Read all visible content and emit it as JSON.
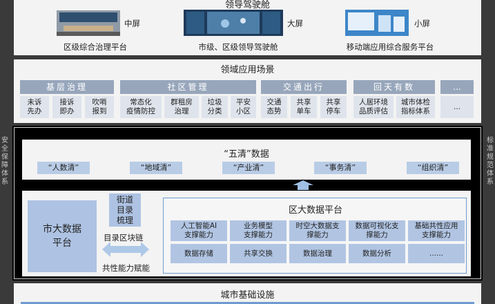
{
  "side_left": "安全保障体系",
  "side_right": "标准规范体系",
  "cockpit": {
    "title": "领导驾驶舱",
    "screens": [
      {
        "size": "中屏",
        "caption": "区级综合治理平台"
      },
      {
        "size": "大屏",
        "caption": "市级、区级领导驾驶舱"
      },
      {
        "size": "小屏",
        "caption": "移动端应用综合服务平台"
      }
    ]
  },
  "scenes": {
    "title": "领域应用场景",
    "groups": [
      {
        "header": "基层治理",
        "items": [
          "未诉\n先办",
          "接诉\n即办",
          "吹哨\n报到"
        ]
      },
      {
        "header": "社区管理",
        "items": [
          "常态化\n疫情防控",
          "群租房\n治理",
          "垃圾\n分类",
          "平安\n小区"
        ]
      },
      {
        "header": "交通出行",
        "items": [
          "交通\n态势",
          "共享\n单车",
          "共享\n停车"
        ]
      },
      {
        "header": "回天有数",
        "items": [
          "人居环境\n品质评估",
          "城市体检\n指标体系"
        ]
      },
      {
        "header": "...",
        "items": [
          "..."
        ]
      }
    ]
  },
  "wuqing": {
    "title": "“五清”数据",
    "tags": [
      "“人数清”",
      "“地域清”",
      "“产业清”",
      "“事务清”",
      "“组织清”"
    ]
  },
  "city_platform": "市大数据\n平台",
  "street": "街道\n目录\n梳理",
  "catalog_chain": "目录区块链",
  "shared_ability": "共性能力赋能",
  "district": {
    "title": "区大数据平台",
    "row1": [
      "人工智能AI\n支撑能力",
      "业务模型\n支撑能力",
      "时空大数据支\n撑能力",
      "数据可视化支\n撑能力",
      "基础共性应用\n支撑能力"
    ],
    "row2": [
      "数据存储",
      "共享交换",
      "数据治理",
      "数据分析",
      "......"
    ]
  },
  "infra": {
    "title": "城市基础设施"
  }
}
